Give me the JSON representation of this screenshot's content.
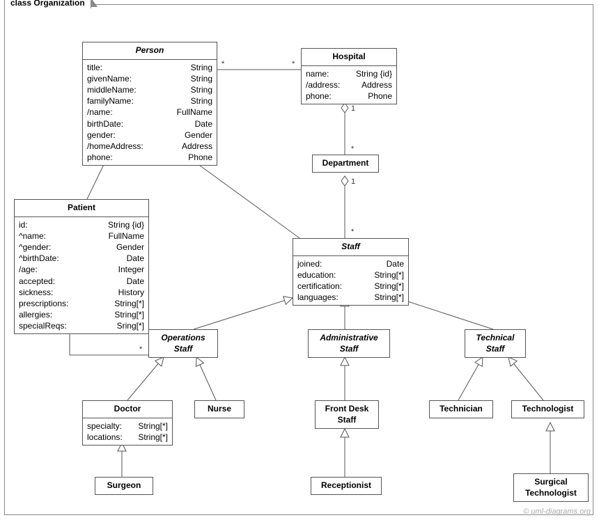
{
  "frame": {
    "label": "class Organization"
  },
  "copyright": "© uml-diagrams.org",
  "classes": {
    "person": {
      "name": "Person",
      "attrs": [
        {
          "n": "title:",
          "t": "String"
        },
        {
          "n": "givenName:",
          "t": "String"
        },
        {
          "n": "middleName:",
          "t": "String"
        },
        {
          "n": "familyName:",
          "t": "String"
        },
        {
          "n": "/name:",
          "t": "FullName"
        },
        {
          "n": "birthDate:",
          "t": "Date"
        },
        {
          "n": "gender:",
          "t": "Gender"
        },
        {
          "n": "/homeAddress:",
          "t": "Address"
        },
        {
          "n": "phone:",
          "t": "Phone"
        }
      ]
    },
    "hospital": {
      "name": "Hospital",
      "attrs": [
        {
          "n": "name:",
          "t": "String {id}"
        },
        {
          "n": "/address:",
          "t": "Address"
        },
        {
          "n": "phone:",
          "t": "Phone"
        }
      ]
    },
    "department": {
      "name": "Department",
      "attrs": []
    },
    "patient": {
      "name": "Patient",
      "attrs": [
        {
          "n": "id:",
          "t": "String {id}"
        },
        {
          "n": "^name:",
          "t": "FullName"
        },
        {
          "n": "^gender:",
          "t": "Gender"
        },
        {
          "n": "^birthDate:",
          "t": "Date"
        },
        {
          "n": "/age:",
          "t": "Integer"
        },
        {
          "n": "accepted:",
          "t": "Date"
        },
        {
          "n": "sickness:",
          "t": "History"
        },
        {
          "n": "prescriptions:",
          "t": "String[*]"
        },
        {
          "n": "allergies:",
          "t": "String[*]"
        },
        {
          "n": "specialReqs:",
          "t": "Sring[*]"
        }
      ]
    },
    "staff": {
      "name": "Staff",
      "attrs": [
        {
          "n": "joined:",
          "t": "Date"
        },
        {
          "n": "education:",
          "t": "String[*]"
        },
        {
          "n": "certification:",
          "t": "String[*]"
        },
        {
          "n": "languages:",
          "t": "String[*]"
        }
      ]
    },
    "opsStaff": {
      "name": "Operations\nStaff",
      "attrs": []
    },
    "adminStaff": {
      "name": "Administrative\nStaff",
      "attrs": []
    },
    "techStaff": {
      "name": "Technical\nStaff",
      "attrs": []
    },
    "doctor": {
      "name": "Doctor",
      "attrs": [
        {
          "n": "specialty:",
          "t": "String[*]"
        },
        {
          "n": "locations:",
          "t": "String[*]"
        }
      ]
    },
    "nurse": {
      "name": "Nurse",
      "attrs": []
    },
    "frontDesk": {
      "name": "Front Desk\nStaff",
      "attrs": []
    },
    "technician": {
      "name": "Technician",
      "attrs": []
    },
    "technologist": {
      "name": "Technologist",
      "attrs": []
    },
    "surgeon": {
      "name": "Surgeon",
      "attrs": []
    },
    "receptionist": {
      "name": "Receptionist",
      "attrs": []
    },
    "surgTech": {
      "name": "Surgical\nTechnologist",
      "attrs": []
    }
  },
  "mults": {
    "m1": "*",
    "m2": "*",
    "m3": "1",
    "m4": "*",
    "m5": "1",
    "m6": "*",
    "m7": "*",
    "m8": "*"
  }
}
